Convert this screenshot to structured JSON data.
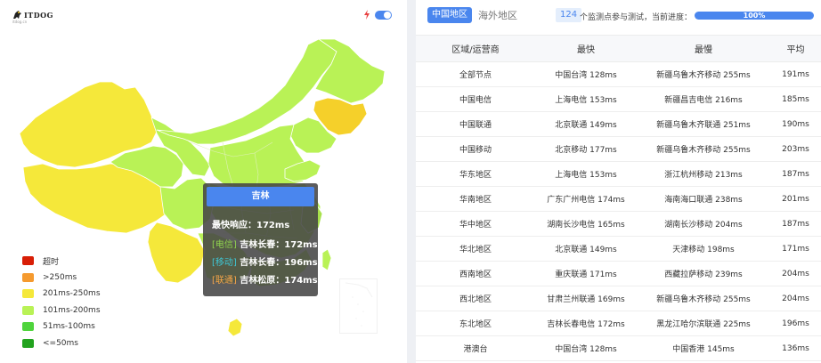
{
  "logo": {
    "text": "ITDOG",
    "sub": "itdog.cn"
  },
  "map_panel": {
    "toggle_on": true,
    "tooltip": {
      "title": "吉林",
      "fastest": "最快响应：172ms",
      "lines": [
        {
          "tag": "[电信]",
          "text": "吉林长春：172ms"
        },
        {
          "tag": "[移动]",
          "text": "吉林长春：196ms"
        },
        {
          "tag": "[联通]",
          "text": "吉林松原：174ms"
        }
      ]
    },
    "legend": [
      {
        "label": "超时",
        "color": "#d81e06"
      },
      {
        "label": ">250ms",
        "color": "#f59a2f"
      },
      {
        "label": "201ms-250ms",
        "color": "#f5e83a"
      },
      {
        "label": "101ms-200ms",
        "color": "#b9f256"
      },
      {
        "label": "51ms-100ms",
        "color": "#4fd43c"
      },
      {
        "label": "<=50ms",
        "color": "#22a31e"
      }
    ]
  },
  "results": {
    "tabs": [
      "中国地区",
      "海外地区"
    ],
    "active_tab": "中国地区",
    "node_count": "124",
    "count_text": "个监测点参与测试，当前进度：",
    "progress_text": "100%",
    "progress": 1.0,
    "headers": [
      "区域/运营商",
      "最快",
      "最慢",
      "平均"
    ],
    "rows": [
      [
        "全部节点",
        "中国台湾 128ms",
        "新疆乌鲁木齐移动 255ms",
        "191ms"
      ],
      [
        "中国电信",
        "上海电信 153ms",
        "新疆昌吉电信 216ms",
        "185ms"
      ],
      [
        "中国联通",
        "北京联通 149ms",
        "新疆乌鲁木齐联通 251ms",
        "190ms"
      ],
      [
        "中国移动",
        "北京移动 177ms",
        "新疆乌鲁木齐移动 255ms",
        "203ms"
      ],
      [
        "华东地区",
        "上海电信 153ms",
        "浙江杭州移动 213ms",
        "187ms"
      ],
      [
        "华南地区",
        "广东广州电信 174ms",
        "海南海口联通 238ms",
        "201ms"
      ],
      [
        "华中地区",
        "湖南长沙电信 165ms",
        "湖南长沙移动 204ms",
        "187ms"
      ],
      [
        "华北地区",
        "北京联通 149ms",
        "天津移动 198ms",
        "171ms"
      ],
      [
        "西南地区",
        "重庆联通 171ms",
        "西藏拉萨移动 239ms",
        "204ms"
      ],
      [
        "西北地区",
        "甘肃兰州联通 169ms",
        "新疆乌鲁木齐移动 255ms",
        "204ms"
      ],
      [
        "东北地区",
        "吉林长春电信 172ms",
        "黑龙江哈尔滨联通 225ms",
        "196ms"
      ],
      [
        "港澳台",
        "中国台湾 128ms",
        "中国香港 145ms",
        "136ms"
      ]
    ]
  }
}
